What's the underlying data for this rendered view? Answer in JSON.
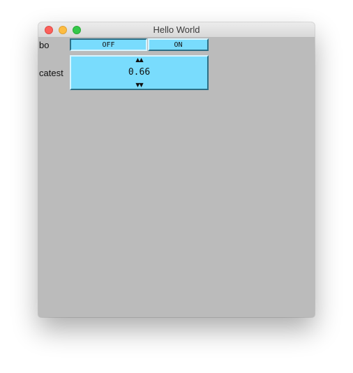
{
  "window": {
    "title": "Hello World"
  },
  "controls": {
    "bo": {
      "label": "bo",
      "off_label": "OFF",
      "on_label": "ON",
      "state": "off"
    },
    "catest": {
      "label": "catest",
      "value": "0.66",
      "up_glyph": "▲▲",
      "down_glyph": "▼▼"
    }
  },
  "colors": {
    "window_background": "#bbbbbb",
    "control_fill": "#79dcfd",
    "close": "#fc605b",
    "minimize": "#fdbc40",
    "maximize": "#34c84a"
  }
}
